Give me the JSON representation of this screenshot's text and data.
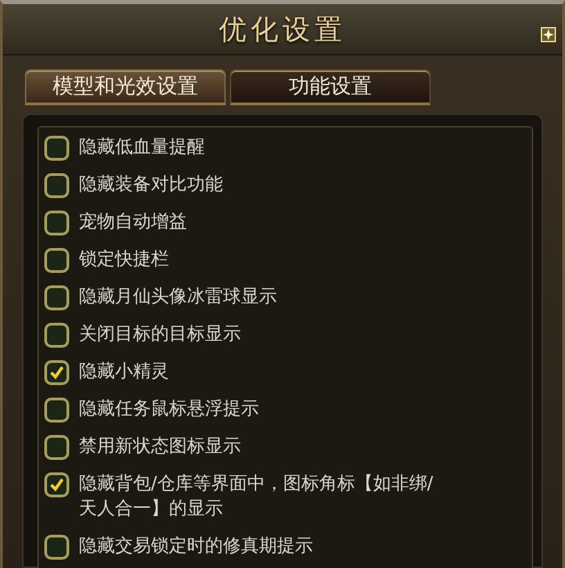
{
  "window": {
    "title": "优化设置"
  },
  "tabs": [
    {
      "label": "模型和光效设置",
      "selected": false
    },
    {
      "label": "功能设置",
      "selected": true
    }
  ],
  "options": [
    {
      "label": "隐藏低血量提醒",
      "checked": false
    },
    {
      "label": "隐藏装备对比功能",
      "checked": false
    },
    {
      "label": "宠物自动增益",
      "checked": false
    },
    {
      "label": "锁定快捷栏",
      "checked": false
    },
    {
      "label": "隐藏月仙头像冰雷球显示",
      "checked": false
    },
    {
      "label": "关闭目标的目标显示",
      "checked": false
    },
    {
      "label": "隐藏小精灵",
      "checked": true
    },
    {
      "label": "隐藏任务鼠标悬浮提示",
      "checked": false
    },
    {
      "label": "禁用新状态图标显示",
      "checked": false
    },
    {
      "label": "隐藏背包/仓库等界面中，图标角标【如非绑/天人合一】的显示",
      "checked": true
    },
    {
      "label": "隐藏交易锁定时的修真期提示",
      "checked": false
    }
  ]
}
